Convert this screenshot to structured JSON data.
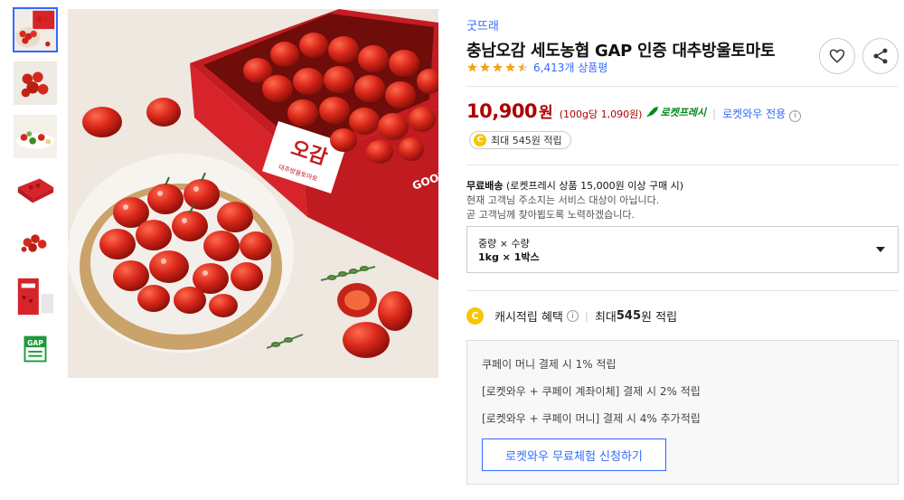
{
  "thumbnails": [
    {
      "name": "thumbnail-1"
    },
    {
      "name": "thumbnail-2"
    },
    {
      "name": "thumbnail-3"
    },
    {
      "name": "thumbnail-4"
    },
    {
      "name": "thumbnail-5"
    },
    {
      "name": "thumbnail-6"
    },
    {
      "name": "thumbnail-7"
    }
  ],
  "main_image": {
    "box_text": "오감",
    "box_subtext": "대추방울토마토",
    "side_text": "GOOD",
    "thumb_badge": "GAP"
  },
  "product": {
    "brand": "굿뜨래",
    "title": "충남오감 세도농협 GAP 인증 대추방울토마토",
    "rating": 4.5,
    "review_count": "6,413개 상품평"
  },
  "price": {
    "amount": "10,900",
    "unit": "원",
    "unit_price": "(100g당 1,090원)",
    "rocket_label": "로켓프레시",
    "wow_only": "로켓와우 전용",
    "info_icon": "i"
  },
  "cash_badge": {
    "coin": "C",
    "text": "최대 545원 적립"
  },
  "delivery": {
    "head_bold": "무료배송",
    "head_rest": " (로켓프레시 상품 15,000원 이상 구매 시)",
    "line1": "현재 고객님 주소지는 서비스 대상이 아닙니다.",
    "line2": "곧 고객님께 찾아뵙도록 노력하겠습니다."
  },
  "option": {
    "label": "중량 × 수량",
    "value": "1kg × 1박스"
  },
  "cash_benefit": {
    "coin": "C",
    "label": "캐시적립 혜택",
    "info_icon": "i",
    "max_prefix": "최대 ",
    "max_amount": "545",
    "max_suffix": "원 적립"
  },
  "benefits": {
    "line1": "쿠페이 머니 결제 시 1% 적립",
    "line2": "[로켓와우 + 쿠페이 계좌이체] 결제 시 2% 적립",
    "line3": "[로켓와우 + 쿠페이 머니] 결제 시 4% 추가적립",
    "trial_button": "로켓와우 무료체험 신청하기"
  },
  "colors": {
    "accent_blue": "#346aff",
    "price_red": "#ae0000",
    "rocket_green": "#00891a",
    "star_orange": "#f2a615",
    "coin_yellow": "#f7c600"
  },
  "icons": [
    "heart-icon",
    "share-icon",
    "star-icon",
    "rocket-icon",
    "info-icon",
    "coin-icon",
    "chevron-down-icon"
  ]
}
